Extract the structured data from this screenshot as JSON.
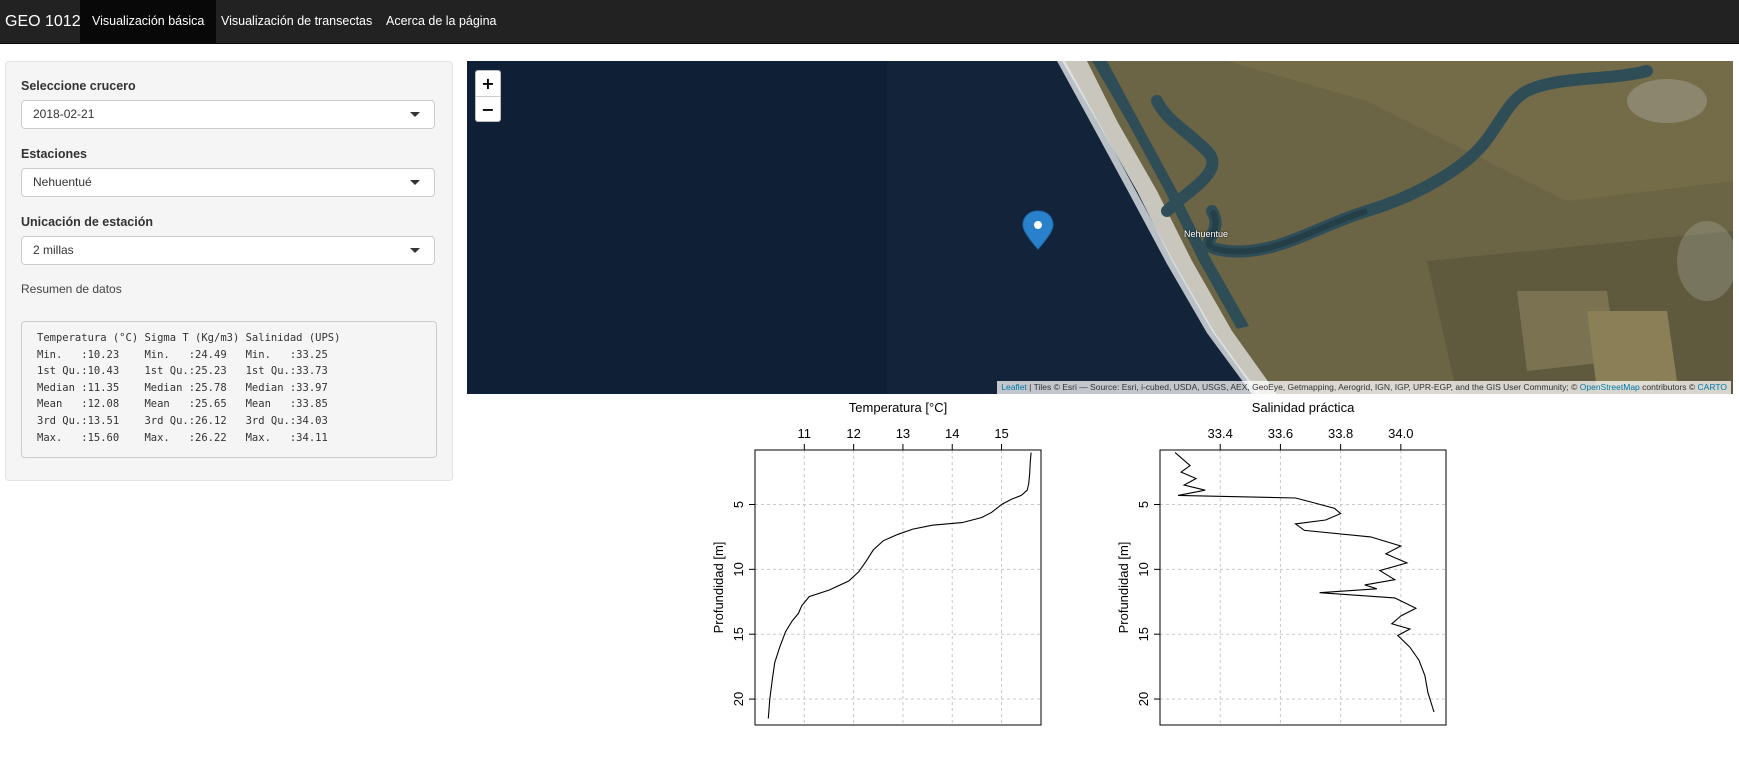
{
  "navbar": {
    "brand": "GEO 1012",
    "tabs": [
      {
        "label": "Visualización básica",
        "active": true
      },
      {
        "label": "Visualización de transectas",
        "active": false
      },
      {
        "label": "Acerca de la página",
        "active": false
      }
    ]
  },
  "sidebar": {
    "cruise_label": "Seleccione crucero",
    "cruise_value": "2018-02-21",
    "stations_label": "Estaciones",
    "stations_value": "Nehuentué",
    "location_label": "Unicación de estación",
    "location_value": "2 millas",
    "summary_label": "Resumen de datos",
    "summary_lines": [
      "Temperatura (°C) Sigma T (Kg/m3) Salinidad (UPS)",
      "Min.   :10.23    Min.   :24.49   Min.   :33.25",
      "1st Qu.:10.43    1st Qu.:25.23   1st Qu.:33.73",
      "Median :11.35    Median :25.78   Median :33.97",
      "Mean   :12.08    Mean   :25.65   Mean   :33.85",
      "3rd Qu.:13.51    3rd Qu.:26.12   3rd Qu.:34.03",
      "Max.   :15.60    Max.   :26.22   Max.   :34.11"
    ]
  },
  "map": {
    "zoom_in": "+",
    "zoom_out": "−",
    "place_label": "Nehuentue",
    "attribution_leaflet": "Leaflet",
    "attribution_mid": " | Tiles © Esri — Source: Esri, i-cubed, USDA, USGS, AEX, GeoEye, Getmapping, Aerogrid, IGN, IGP, UPR-EGP, and the GIS User Community; © ",
    "attribution_osm": "OpenStreetMap",
    "attribution_contrib": " contributors © ",
    "attribution_carto": "CARTO",
    "colors": {
      "ocean": "#12233a",
      "land": "#6b6546",
      "river": "#2f4d57",
      "marker": "#2a81cb"
    }
  },
  "chart_data": [
    {
      "type": "line",
      "title": "Temperatura [°C]",
      "ylabel": "Profundidad [m]",
      "xticks": [
        11,
        12,
        13,
        14,
        15
      ],
      "yticks": [
        5,
        10,
        15,
        20
      ],
      "xlim": [
        10.0,
        15.8
      ],
      "ylim": [
        22,
        0.8
      ],
      "grid": true,
      "x_axis_position": "top",
      "series": [
        {
          "values": [
            [
              15.6,
              1
            ],
            [
              15.58,
              1.8
            ],
            [
              15.57,
              2.6
            ],
            [
              15.55,
              3.4
            ],
            [
              15.52,
              3.9
            ],
            [
              15.4,
              4.3
            ],
            [
              15.2,
              4.6
            ],
            [
              15.0,
              5.0
            ],
            [
              14.8,
              5.6
            ],
            [
              14.6,
              6.0
            ],
            [
              14.2,
              6.4
            ],
            [
              13.6,
              6.6
            ],
            [
              13.2,
              6.9
            ],
            [
              12.9,
              7.3
            ],
            [
              12.6,
              7.8
            ],
            [
              12.4,
              8.5
            ],
            [
              12.25,
              9.4
            ],
            [
              12.1,
              10.2
            ],
            [
              11.9,
              10.9
            ],
            [
              11.5,
              11.6
            ],
            [
              11.1,
              12.1
            ],
            [
              10.95,
              12.8
            ],
            [
              10.88,
              13.4
            ],
            [
              10.75,
              14.0
            ],
            [
              10.62,
              14.8
            ],
            [
              10.5,
              16.0
            ],
            [
              10.4,
              17.2
            ],
            [
              10.35,
              18.5
            ],
            [
              10.3,
              20.0
            ],
            [
              10.27,
              21.5
            ]
          ]
        }
      ]
    },
    {
      "type": "line",
      "title": "Salinidad práctica",
      "ylabel": "Profundidad [m]",
      "xticks": [
        33.4,
        33.6,
        33.8,
        34.0
      ],
      "xtick_labels": [
        "33.4",
        "33.6",
        "33.8",
        "34.0"
      ],
      "yticks": [
        5,
        10,
        15,
        20
      ],
      "xlim": [
        33.2,
        34.15
      ],
      "ylim": [
        22,
        0.8
      ],
      "grid": true,
      "x_axis_position": "top",
      "series": [
        {
          "values": [
            [
              33.25,
              1
            ],
            [
              33.3,
              2.0
            ],
            [
              33.27,
              2.5
            ],
            [
              33.32,
              3.0
            ],
            [
              33.28,
              3.5
            ],
            [
              33.35,
              3.9
            ],
            [
              33.26,
              4.3
            ],
            [
              33.65,
              4.5
            ],
            [
              33.7,
              4.8
            ],
            [
              33.78,
              5.3
            ],
            [
              33.8,
              5.7
            ],
            [
              33.75,
              6.2
            ],
            [
              33.65,
              6.5
            ],
            [
              33.68,
              7.0
            ],
            [
              33.9,
              7.5
            ],
            [
              34.0,
              8.2
            ],
            [
              33.95,
              8.8
            ],
            [
              34.02,
              9.5
            ],
            [
              33.93,
              10.1
            ],
            [
              33.98,
              10.8
            ],
            [
              33.88,
              11.2
            ],
            [
              33.92,
              11.5
            ],
            [
              33.73,
              11.8
            ],
            [
              33.98,
              12.2
            ],
            [
              34.05,
              13.0
            ],
            [
              34.0,
              13.6
            ],
            [
              33.97,
              14.2
            ],
            [
              34.03,
              14.6
            ],
            [
              33.99,
              15.1
            ],
            [
              34.03,
              16.0
            ],
            [
              34.06,
              17.0
            ],
            [
              34.08,
              18.2
            ],
            [
              34.09,
              19.5
            ],
            [
              34.11,
              21.0
            ]
          ]
        }
      ]
    }
  ]
}
